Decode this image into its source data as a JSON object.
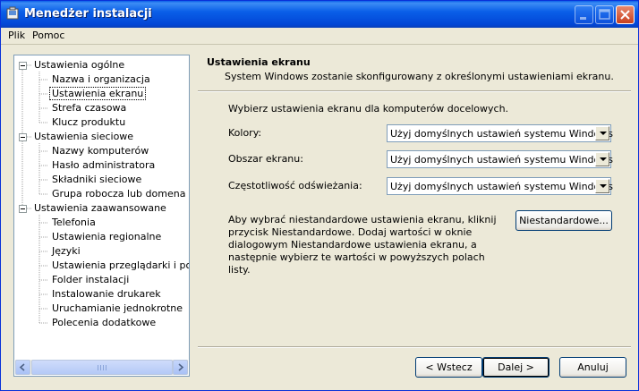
{
  "window": {
    "title": "Menedżer instalacji"
  },
  "menu": {
    "items": [
      {
        "label": "Plik"
      },
      {
        "label": "Pomoc"
      }
    ]
  },
  "tree": {
    "items": [
      {
        "label": "Ustawienia ogólne",
        "level": 0
      },
      {
        "label": "Nazwa i organizacja",
        "level": 1
      },
      {
        "label": "Ustawienia ekranu",
        "level": 1,
        "selected": true
      },
      {
        "label": "Strefa czasowa",
        "level": 1
      },
      {
        "label": "Klucz produktu",
        "level": 1
      },
      {
        "label": "Ustawienia sieciowe",
        "level": 0
      },
      {
        "label": "Nazwy komputerów",
        "level": 1
      },
      {
        "label": "Hasło administratora",
        "level": 1
      },
      {
        "label": "Składniki sieciowe",
        "level": 1
      },
      {
        "label": "Grupa robocza lub domena",
        "level": 1
      },
      {
        "label": "Ustawienia zaawansowane",
        "level": 0
      },
      {
        "label": "Telefonia",
        "level": 1
      },
      {
        "label": "Ustawienia regionalne",
        "level": 1
      },
      {
        "label": "Języki",
        "level": 1
      },
      {
        "label": "Ustawienia przeglądarki i powłoki",
        "level": 1
      },
      {
        "label": "Folder instalacji",
        "level": 1
      },
      {
        "label": "Instalowanie drukarek",
        "level": 1
      },
      {
        "label": "Uruchamianie jednokrotne",
        "level": 1
      },
      {
        "label": "Polecenia dodatkowe",
        "level": 1
      }
    ]
  },
  "panel": {
    "title": "Ustawienia ekranu",
    "description": "System Windows zostanie skonfigurowany z określonymi ustawieniami ekranu.",
    "intro": "Wybierz ustawienia ekranu dla komputerów docelowych.",
    "fields": {
      "colors": {
        "label": "Kolory:",
        "value": "Użyj domyślnych ustawień systemu Windows"
      },
      "area": {
        "label": "Obszar ekranu:",
        "value": "Użyj domyślnych ustawień systemu Windows"
      },
      "refresh": {
        "label": "Częstotliwość odświeżania:",
        "value": "Użyj domyślnych ustawień systemu Windows"
      }
    },
    "custom_text": "Aby wybrać niestandardowe ustawienia ekranu, kliknij przycisk Niestandardowe. Dodaj wartości w oknie dialogowym Niestandardowe ustawienia ekranu, a następnie wybierz te wartości w powyższych polach listy.",
    "custom_button": "Niestandardowe..."
  },
  "buttons": {
    "back": "< Wstecz",
    "next": "Dalej >",
    "cancel": "Anuluj"
  }
}
